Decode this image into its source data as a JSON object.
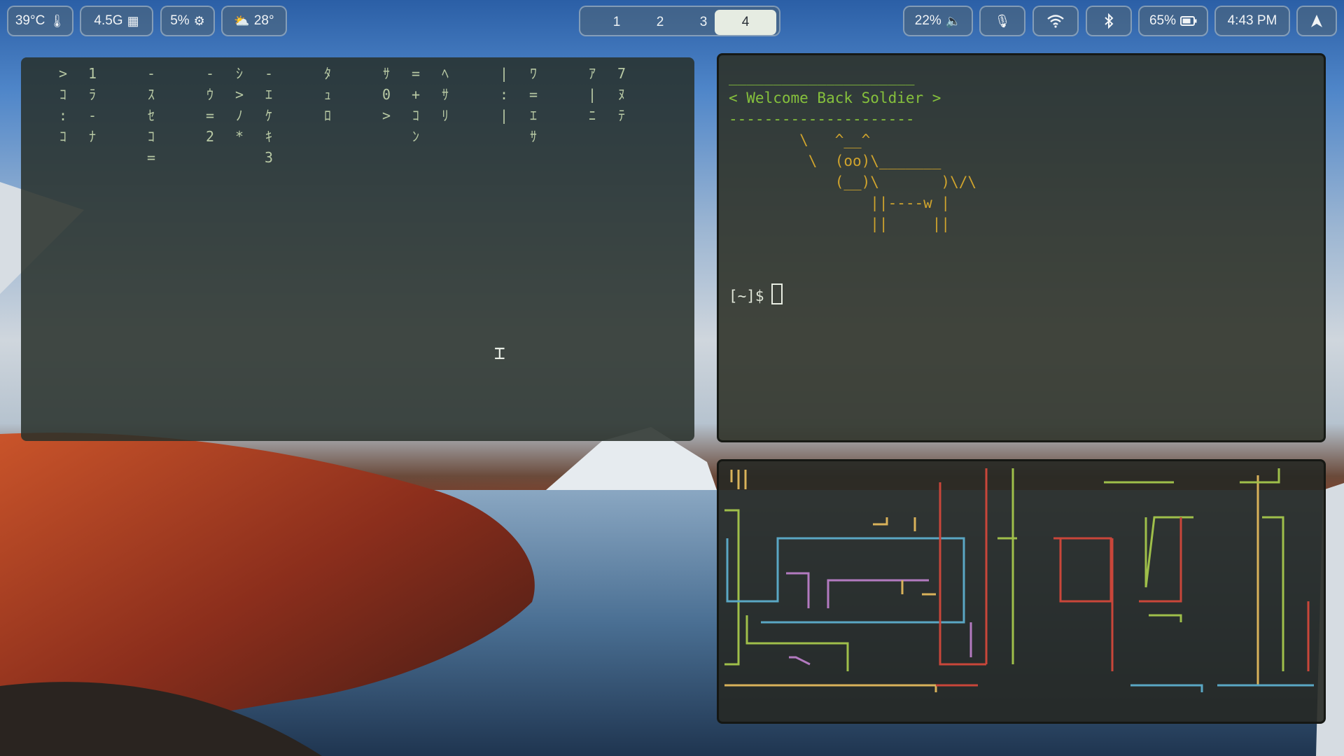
{
  "topbar": {
    "temperature": "39°C",
    "memory": "4.5G",
    "cpu": "5%",
    "weather": "28°",
    "volume": "22%",
    "battery": "65%",
    "clock": "4:43 PM",
    "icons": {
      "temperature": "thermometer-icon",
      "memory": "memory-icon",
      "cpu": "cpu-chip-icon",
      "weather": "sun-cloud-icon",
      "volume": "speaker-icon",
      "mic": "microphone-icon",
      "wifi": "wifi-icon",
      "bluetooth": "bluetooth-icon",
      "battery": "battery-icon",
      "launcher": "launcher-arrow-icon"
    }
  },
  "workspaces": {
    "items": [
      "1",
      "2",
      "3",
      "4"
    ],
    "active": "4"
  },
  "terminal": {
    "banner_top": "_____________________",
    "banner_text": "< Welcome Back Soldier >",
    "banner_bottom": "---------------------",
    "cow": [
      "        \\   ^__^",
      "         \\  (oo)\\_______",
      "            (__)\\       )\\/\\",
      "                ||----w |",
      "                ||     ||"
    ],
    "prompt": "[~]$"
  },
  "matrix": {
    "columns": [
      ">ｺ:ｺ",
      "1ﾗ-ﾅ",
      " ",
      "-ｽｾｺ=",
      " ",
      "-ｳ=2",
      "ｼ>ﾉ*",
      "-ｴｹｷ3",
      " ",
      "ﾀｭﾛ",
      " ",
      "ｻ0>",
      "=+ｺﾝ",
      "ﾍｻﾘ",
      " ",
      "|:|",
      "ﾜ=ｴｻ",
      " ",
      "ｱ|ﾆ",
      "7ﾇﾃ"
    ]
  },
  "colors": {
    "matrix_text": "#b8c9a4",
    "cow": "#d0a42d",
    "banner": "#86c13c",
    "pipe_yellow": "#d9b25a",
    "pipe_green": "#9fbf4a",
    "pipe_blue": "#5aa7c4",
    "pipe_red": "#c9463a",
    "pipe_purple": "#b37ac0",
    "pipe_cyan": "#4fb0b8"
  }
}
